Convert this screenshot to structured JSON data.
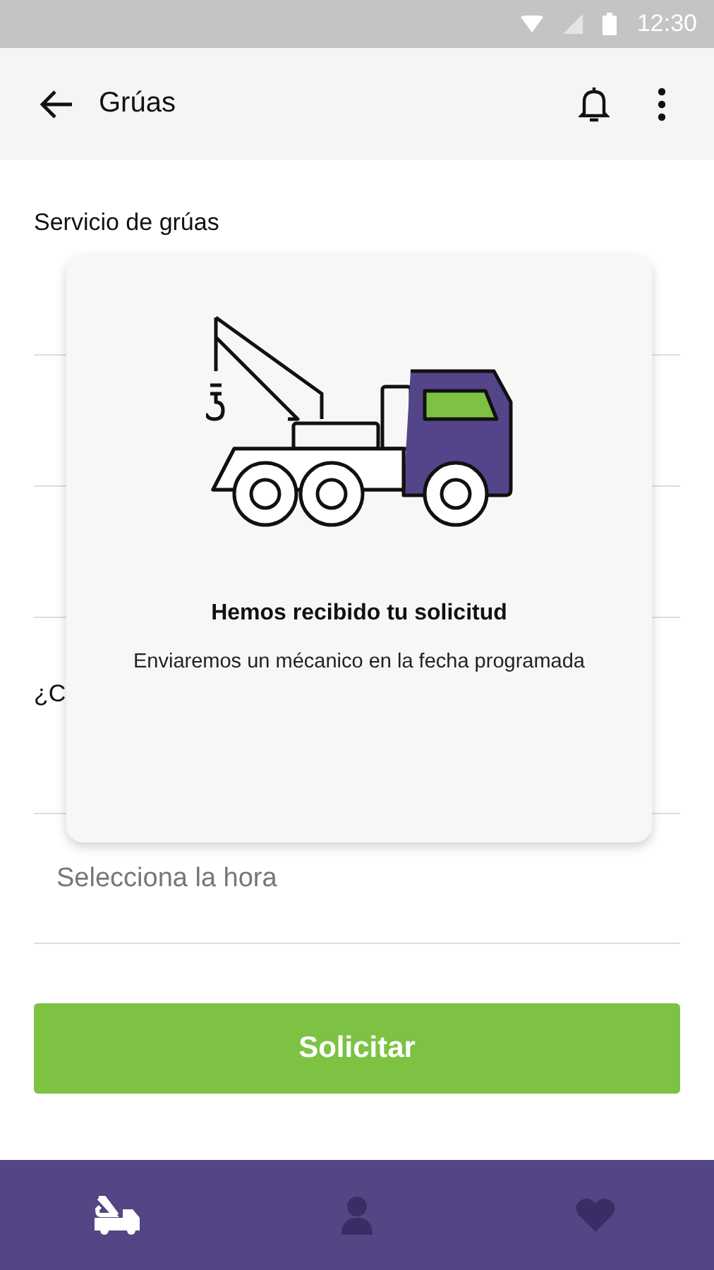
{
  "status_bar": {
    "time": "12:30"
  },
  "app_bar": {
    "title": "Grúas"
  },
  "form": {
    "section_title": "Servicio de grúas",
    "section_2_title": "¿C",
    "time_field": {
      "placeholder": "Selecciona la hora"
    },
    "submit": "Solicitar"
  },
  "dialog": {
    "title": "Hemos recibido tu solicitud",
    "message": "Enviaremos un mécanico en la fecha programada"
  },
  "bottom_nav": [
    {
      "kind": "truck",
      "selected": true
    },
    {
      "kind": "person",
      "selected": false
    },
    {
      "kind": "heart",
      "selected": false
    }
  ]
}
